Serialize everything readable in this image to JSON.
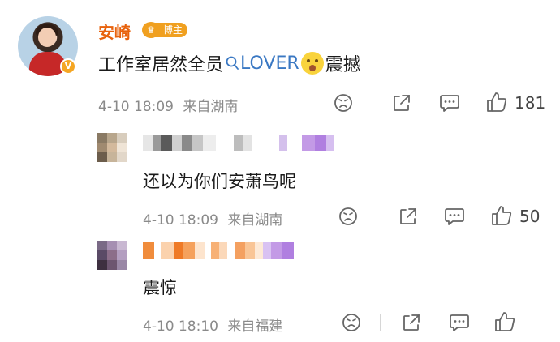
{
  "main_comment": {
    "username": "安崎",
    "badge": "博主",
    "verified_mark": "V",
    "text_before": "工作室居然全员",
    "topic_icon": "search-icon",
    "topic": "LOVER",
    "emoji": "surprised-face",
    "text_after": "震撼",
    "timestamp": "4-10 18:09",
    "location": "来自湖南",
    "like_count": "181"
  },
  "replies": [
    {
      "text": "还以为你们安萧鸟呢",
      "timestamp": "4-10 18:09",
      "location": "来自湖南",
      "like_count": "50"
    },
    {
      "text": "震惊",
      "timestamp": "4-10 18:10",
      "location": "来自福建",
      "like_count": ""
    }
  ],
  "colors": {
    "username": "#e8620c",
    "badge": "#f0a020",
    "link": "#3a78c3",
    "meta": "#8a8a8a"
  },
  "icons": [
    "angry-face-icon",
    "share-icon",
    "comment-icon",
    "like-icon"
  ]
}
